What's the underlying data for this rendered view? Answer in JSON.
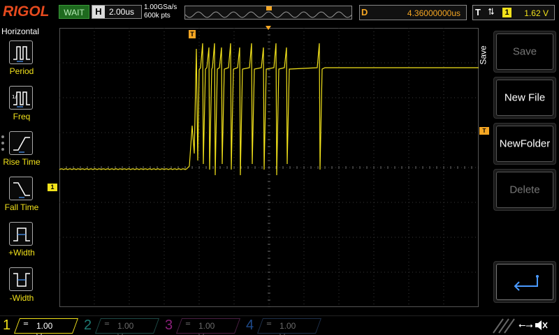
{
  "topbar": {
    "brand": "RIGOL",
    "run_status": "WAIT",
    "horizontal_key": "H",
    "timebase": "2.00us",
    "sample_rate": "1.00GSa/s",
    "memory_depth": "600k pts",
    "delay_key": "D",
    "delay_value": "4.36000000us",
    "trigger_key": "T",
    "trigger_edge_symbol": "⮁",
    "trigger_source": "1",
    "trigger_level": "1.62 V"
  },
  "left_panel": {
    "title": "Horizontal",
    "items": [
      {
        "label": "Period",
        "icon": "period-icon"
      },
      {
        "label": "Freq",
        "icon": "frequency-icon"
      },
      {
        "label": "Rise Time",
        "icon": "rise-time-icon"
      },
      {
        "label": "Fall Time",
        "icon": "fall-time-icon"
      },
      {
        "label": "+Width",
        "icon": "positive-width-icon"
      },
      {
        "label": "-Width",
        "icon": "negative-width-icon"
      }
    ]
  },
  "markers": {
    "trigger_position": "T",
    "trigger_level": "T",
    "ch1_ground": "1"
  },
  "right_menu": {
    "title": "Save",
    "buttons": [
      {
        "label": "Save",
        "state": "disabled"
      },
      {
        "label": "New File",
        "state": "enabled"
      },
      {
        "label": "NewFolder",
        "state": "enabled"
      },
      {
        "label": "Delete",
        "state": "disabled"
      },
      {
        "label": "",
        "state": "enabled",
        "icon": "return-arrow-icon"
      }
    ]
  },
  "channels": [
    {
      "num": "1",
      "coupling_icon": "dc-coupling-icon",
      "scale": "1.00 V",
      "color": "#f2e21b",
      "active": true
    },
    {
      "num": "2",
      "coupling_icon": "dc-coupling-icon",
      "scale": "1.00 V",
      "color": "#1e7a73",
      "active": false
    },
    {
      "num": "3",
      "coupling_icon": "dc-coupling-icon",
      "scale": "1.00 V",
      "color": "#8a1f7a",
      "active": false
    },
    {
      "num": "4",
      "coupling_icon": "dc-coupling-icon",
      "scale": "1.00 V",
      "color": "#1e4a8a",
      "active": false
    }
  ],
  "colors": {
    "brand": "#e64a1e",
    "trace_ch1": "#f2e21b",
    "trigger_marker": "#f5a623",
    "wait_bg": "#1e6a1e",
    "grid": "#3a3a3a"
  }
}
